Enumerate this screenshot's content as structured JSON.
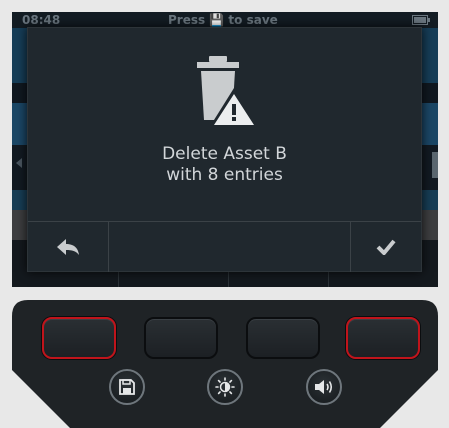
{
  "status_bar": {
    "time": "08:48",
    "hint": "Press 💾 to save"
  },
  "dialog": {
    "icon": "trash-warning-icon",
    "message": "Delete Asset B\nwith 8 entries",
    "back_icon": "back-arrow-icon",
    "confirm_icon": "checkmark-icon"
  },
  "keypad": {
    "soft_keys": [
      "soft-key-1",
      "soft-key-2",
      "soft-key-3",
      "soft-key-4"
    ],
    "round_keys": [
      "save-icon",
      "brightness-icon",
      "volume-icon"
    ]
  },
  "colors": {
    "screen_bg": "#0d1318",
    "dialog_bg": "#20282e",
    "text": "#d2d6d9",
    "highlight_red": "#c0141b",
    "keypad_body": "#1f2326"
  }
}
